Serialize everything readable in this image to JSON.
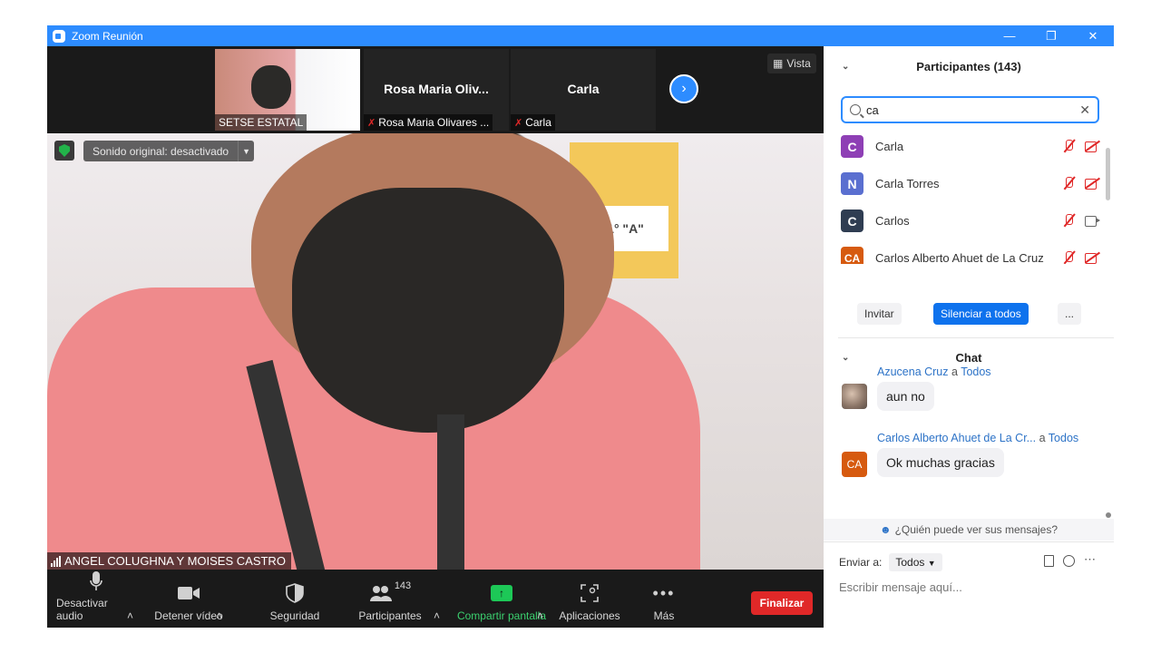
{
  "window": {
    "title": "Zoom Reunión"
  },
  "thumbnails": [
    {
      "name": "SETSE ESTATAL"
    },
    {
      "display": "Rosa Maria Oliv...",
      "name": "Rosa Maria Olivares ..."
    },
    {
      "display": "Carla",
      "name": "Carla"
    }
  ],
  "view_button": "Vista",
  "main_video": {
    "sound_label": "Sonido original: desactivado",
    "speaker_name": "ANGEL COLUGHNA Y MOISES CASTRO",
    "box_text": "1° \"A\""
  },
  "toolbar": {
    "mute": "Desactivar audio",
    "video": "Detener vídeo",
    "security": "Seguridad",
    "participants": "Participantes",
    "participants_count": "143",
    "share": "Compartir pantalla",
    "apps": "Aplicaciones",
    "more": "Más",
    "end": "Finalizar"
  },
  "participants_panel": {
    "title": "Participantes (143)",
    "search_value": "ca",
    "items": [
      {
        "initial": "C",
        "name": "Carla",
        "color": "#8e3fb5",
        "cam": "off"
      },
      {
        "initial": "N",
        "name": "Carla Torres",
        "color": "#5a6fd0",
        "cam": "off"
      },
      {
        "initial": "C",
        "name": "Carlos",
        "color": "#2f3d52",
        "cam": "on"
      },
      {
        "initial": "CA",
        "name": "Carlos Alberto Ahuet de La Cruz",
        "color": "#d65a0f",
        "cam": "off"
      }
    ],
    "invite": "Invitar",
    "mute_all": "Silenciar a todos",
    "more": "..."
  },
  "chat": {
    "title": "Chat",
    "messages": [
      {
        "from": "Azucena Cruz",
        "sep": "a",
        "to": "Todos",
        "text": "aun no"
      },
      {
        "from": "Carlos Alberto Ahuet de La Cr...",
        "sep": "a",
        "to": "Todos",
        "text": "Ok muchas gracias",
        "initial": "CA"
      }
    ],
    "who_can_see": "¿Quién puede ver sus mensajes?",
    "send_to_label": "Enviar a:",
    "send_to_value": "Todos",
    "placeholder": "Escribir mensaje aquí..."
  },
  "colors": {
    "accent": "#2d8cff",
    "end": "#e02828",
    "share": "#1dc857"
  }
}
